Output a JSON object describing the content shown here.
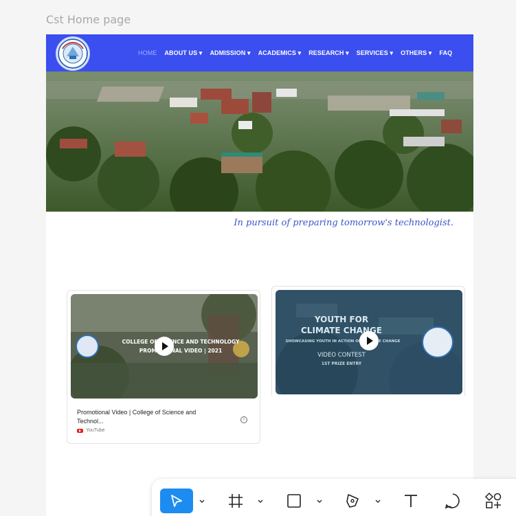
{
  "frame": {
    "label": "Cst Home page"
  },
  "nav": {
    "items": [
      {
        "label": "HOME",
        "active": true
      },
      {
        "label": "ABOUT US ▾"
      },
      {
        "label": "ADMISSION ▾"
      },
      {
        "label": "ACADEMICS ▾"
      },
      {
        "label": "RESEARCH ▾"
      },
      {
        "label": "SERVICES ▾"
      },
      {
        "label": "OTHERS ▾"
      },
      {
        "label": "FAQ"
      }
    ]
  },
  "tagline": "In pursuit of preparing tomorrow's technologist.",
  "videos": [
    {
      "thumb_line1": "COLLEGE OF SCIENCE AND TECHNOLOGY",
      "thumb_line2": "PROMOTIONAL VIDEO | 2021",
      "title": "Promotional Video | College of Science and Technol...",
      "source": "YouTube"
    },
    {
      "thumb_line1": "YOUTH FOR",
      "thumb_line2": "CLIMATE CHANGE",
      "thumb_line3": "SHOWCASING YOUTH IN ACTION ON CLIMATE CHANGE",
      "thumb_line4": "VIDEO CONTEST",
      "thumb_line5": "1ST PRIZE ENTRY"
    }
  ],
  "toolbar": {
    "tools": [
      "move-tool",
      "frame-tool",
      "rectangle-tool",
      "pen-tool",
      "text-tool",
      "comment-tool",
      "actions-tool"
    ],
    "active_color": "#1d8cf0"
  },
  "colors": {
    "nav_bg": "#3b4ef0",
    "tagline": "#3c55c8"
  }
}
